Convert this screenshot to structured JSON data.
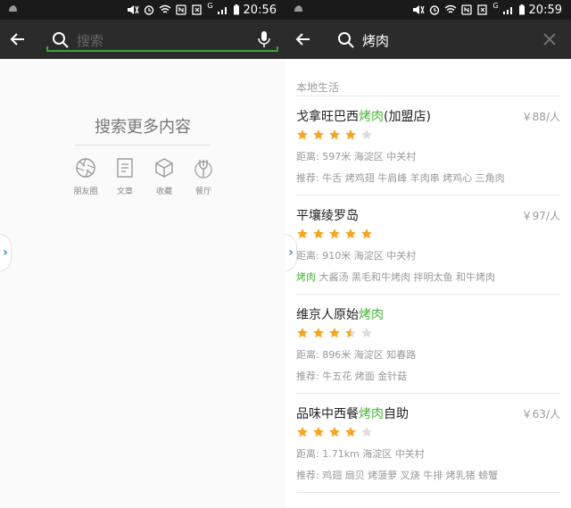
{
  "left_screen": {
    "status": {
      "time": "20:56",
      "network": "G"
    },
    "search": {
      "placeholder": "搜索"
    },
    "more_title": "搜索更多内容",
    "categories": [
      {
        "label": "朋友圈",
        "icon": "aperture-icon"
      },
      {
        "label": "文章",
        "icon": "document-icon"
      },
      {
        "label": "收藏",
        "icon": "cube-icon"
      },
      {
        "label": "餐厅",
        "icon": "utensils-icon"
      }
    ],
    "edge_handle": "›"
  },
  "right_screen": {
    "status": {
      "time": "20:59",
      "network": "G"
    },
    "search": {
      "query": "烤肉"
    },
    "section_title": "本地生活",
    "edge_handle": "›",
    "results": [
      {
        "name_before": "戈拿旺巴西",
        "name_highlight": "烤肉",
        "name_after": "(加盟店)",
        "price": "￥88/人",
        "rating": 4.0,
        "distance": "距离: 597米 海淀区 中关村",
        "rec_prefix": "推荐: ",
        "rec_highlight": "",
        "rec_rest": "牛舌 烤鸡翅 牛肩峰 羊肉串 烤鸡心 三角肉"
      },
      {
        "name_before": "平壤绫罗岛",
        "name_highlight": "",
        "name_after": "",
        "price": "￥97/人",
        "rating": 5.0,
        "distance": "距离: 910米 海淀区 中关村",
        "rec_prefix": "",
        "rec_highlight": "烤肉",
        "rec_rest": " 大酱汤 黑毛和牛烤肉 拌明太鱼 和牛烤肉"
      },
      {
        "name_before": "维京人原始",
        "name_highlight": "烤肉",
        "name_after": "",
        "price": "",
        "rating": 3.5,
        "distance": "距离: 896米 海淀区 知春路",
        "rec_prefix": "推荐: ",
        "rec_highlight": "",
        "rec_rest": "牛五花 烤面 金针菇"
      },
      {
        "name_before": "品味中西餐",
        "name_highlight": "烤肉",
        "name_after": "自助",
        "price": "￥63/人",
        "rating": 4.0,
        "distance": "距离: 1.71km 海淀区 中关村",
        "rec_prefix": "推荐: ",
        "rec_highlight": "",
        "rec_rest": "鸡翅 扇贝 烤菠萝 叉烧 牛排 烤乳猪 螃蟹"
      }
    ]
  },
  "colors": {
    "toolbar": "#2b2b2b",
    "statusbar": "#1a1a1a",
    "accent_green": "#4bb33c",
    "star_on": "#f5a623",
    "star_off": "#dddddd"
  }
}
